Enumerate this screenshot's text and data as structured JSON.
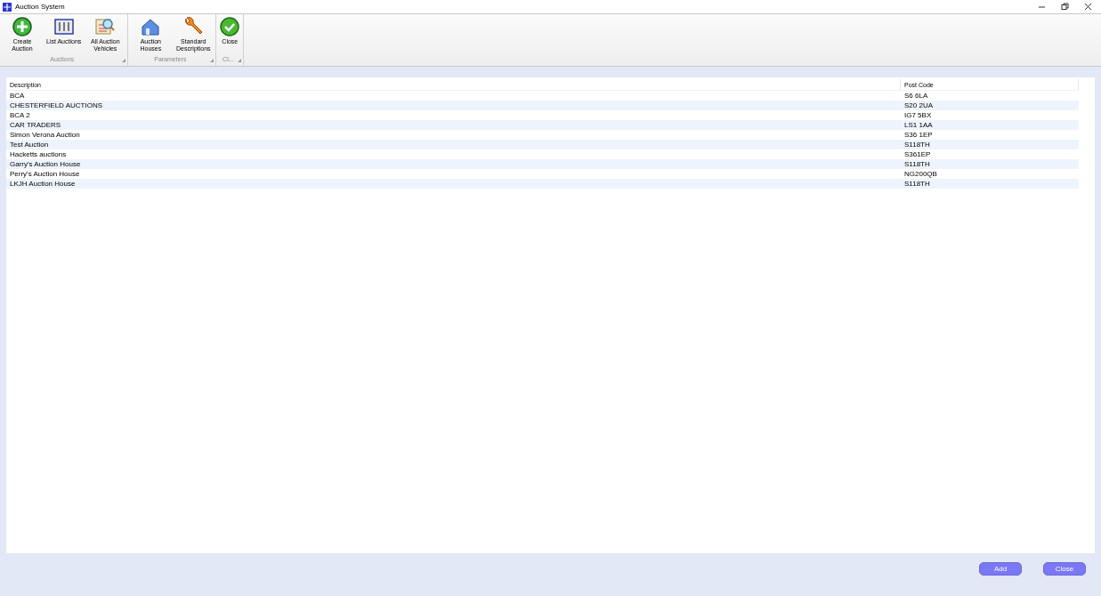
{
  "window": {
    "title": "Auction System"
  },
  "ribbon": {
    "groups": [
      {
        "label": "Auctions",
        "buttons": [
          {
            "kind": "create",
            "label": "Create Auction"
          },
          {
            "kind": "list",
            "label": "List Auctions"
          },
          {
            "kind": "vehicles",
            "label": "All Auction Vehicles"
          }
        ]
      },
      {
        "label": "Parameters",
        "buttons": [
          {
            "kind": "house",
            "label": "Auction Houses"
          },
          {
            "kind": "wrench",
            "label": "Standard Descriptions"
          }
        ]
      },
      {
        "label": "Cl...",
        "buttons": [
          {
            "kind": "close",
            "label": "Close"
          }
        ]
      }
    ]
  },
  "table": {
    "columns": [
      "Description",
      "Post Code"
    ],
    "rows": [
      [
        "BCA",
        "S6 6LA"
      ],
      [
        "CHESTERFIELD AUCTIONS",
        "S20 2UA"
      ],
      [
        "BCA 2",
        "IG7 5BX"
      ],
      [
        "CAR TRADERS",
        "LS1 1AA"
      ],
      [
        "Simon Verona Auction",
        "S36 1EP"
      ],
      [
        "Test Auction",
        "S118TH"
      ],
      [
        "Hacketts auctions",
        "S361EP"
      ],
      [
        "Garry's Auction House",
        "S118TH"
      ],
      [
        "Perry's Auction House",
        "NG200QB"
      ],
      [
        "LKJH Auction House",
        "S118TH"
      ]
    ]
  },
  "buttons": [
    "Add",
    "Close"
  ]
}
